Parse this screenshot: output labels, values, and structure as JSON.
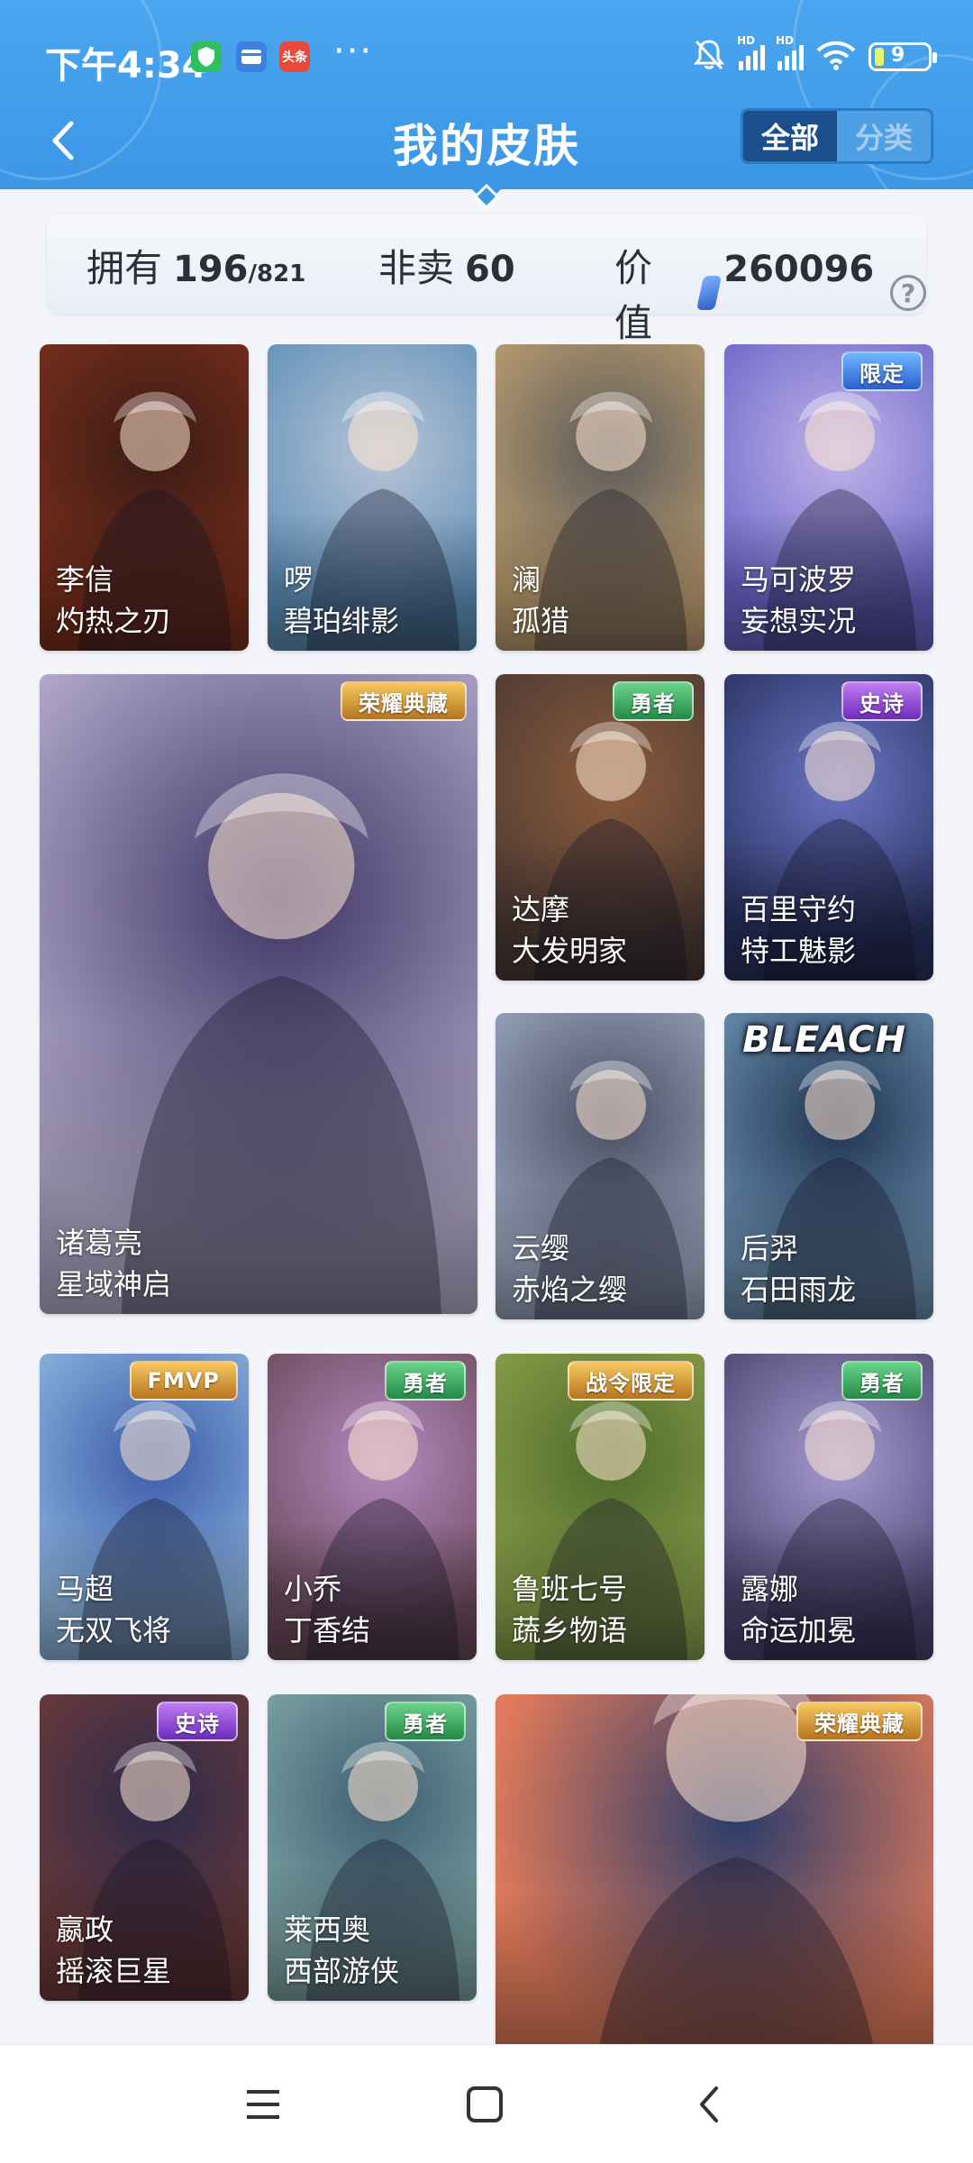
{
  "status_bar": {
    "time": "下午4:34",
    "dots": "···",
    "signal1_label": "HD",
    "signal2_label": "HD",
    "battery": "9",
    "icons": [
      "shield-app-icon",
      "card-app-icon",
      "toutiao-app-icon",
      "mute-icon",
      "signal-icon",
      "wifi-icon",
      "battery-icon"
    ],
    "toutiao_label": "头条"
  },
  "header": {
    "title": "我的皮肤",
    "back_icon": "back-icon",
    "segment": {
      "all": "全部",
      "category": "分类"
    }
  },
  "stats": {
    "owned_label": "拥有",
    "owned_value": "196",
    "owned_total": "/821",
    "unsold_label": "非卖",
    "unsold_value": "60",
    "value_label": "价值",
    "value_amount": "260096",
    "help_symbol": "?"
  },
  "cards": [
    {
      "hero": "李信",
      "skin": "灼热之刃",
      "badge": "",
      "colors": [
        "#7a2f1c",
        "#3a1b14"
      ]
    },
    {
      "hero": "啰",
      "skin": "碧珀绯影",
      "badge": "",
      "colors": [
        "#5d8fb8",
        "#b9c4d6"
      ]
    },
    {
      "hero": "澜",
      "skin": "孤猎",
      "badge": "",
      "colors": [
        "#c0a070",
        "#5b5a5a"
      ]
    },
    {
      "hero": "马可波罗",
      "skin": "妄想实况",
      "badge": "限定",
      "badge_style": "blue",
      "colors": [
        "#6a64c9",
        "#c1b4e8"
      ]
    },
    {
      "hero": "诸葛亮",
      "skin": "星域神启",
      "badge": "荣耀典藏",
      "badge_style": "gold",
      "colors": [
        "#bdb4d6",
        "#3d3463"
      ]
    },
    {
      "hero": "达摩",
      "skin": "大发明家",
      "badge": "勇者",
      "badge_style": "green",
      "colors": [
        "#4c3a34",
        "#8a5a3a"
      ]
    },
    {
      "hero": "百里守约",
      "skin": "特工魅影",
      "badge": "史诗",
      "badge_style": "purple",
      "colors": [
        "#28305e",
        "#6a76c4"
      ]
    },
    {
      "hero": "云缨",
      "skin": "赤焰之缨",
      "badge": "",
      "colors": [
        "#9aa6bf",
        "#4b4f63"
      ]
    },
    {
      "hero": "后羿",
      "skin": "石田雨龙",
      "badge": "BLEACH",
      "badge_style": "bleach",
      "colors": [
        "#6b8fb0",
        "#1f3350"
      ]
    },
    {
      "hero": "马超",
      "skin": "无双飞将",
      "badge": "FMVP",
      "badge_style": "gold",
      "colors": [
        "#8fb7e0",
        "#3b5aa8"
      ]
    },
    {
      "hero": "小乔",
      "skin": "丁香结",
      "badge": "勇者",
      "badge_style": "green",
      "colors": [
        "#6b4a5a",
        "#b58ac1"
      ]
    },
    {
      "hero": "鲁班七号",
      "skin": "蔬乡物语",
      "badge": "战令限定",
      "badge_style": "gold",
      "colors": [
        "#8aa04a",
        "#4f6a2a"
      ]
    },
    {
      "hero": "露娜",
      "skin": "命运加冕",
      "badge": "勇者",
      "badge_style": "green",
      "colors": [
        "#4b4470",
        "#a79bd0"
      ]
    },
    {
      "hero": "嬴政",
      "skin": "摇滚巨星",
      "badge": "史诗",
      "badge_style": "purple",
      "colors": [
        "#6d3a3a",
        "#2c2a4a"
      ]
    },
    {
      "hero": "莱西奥",
      "skin": "西部游侠",
      "badge": "勇者",
      "badge_style": "green",
      "colors": [
        "#7ea6a6",
        "#3f5e72"
      ]
    },
    {
      "hero": "",
      "skin": "",
      "badge": "荣耀典藏",
      "badge_style": "gold",
      "colors": [
        "#e07a5a",
        "#2b3c6b"
      ]
    }
  ],
  "nav": {
    "icons": [
      "menu-icon",
      "home-icon",
      "back-nav-icon"
    ]
  }
}
